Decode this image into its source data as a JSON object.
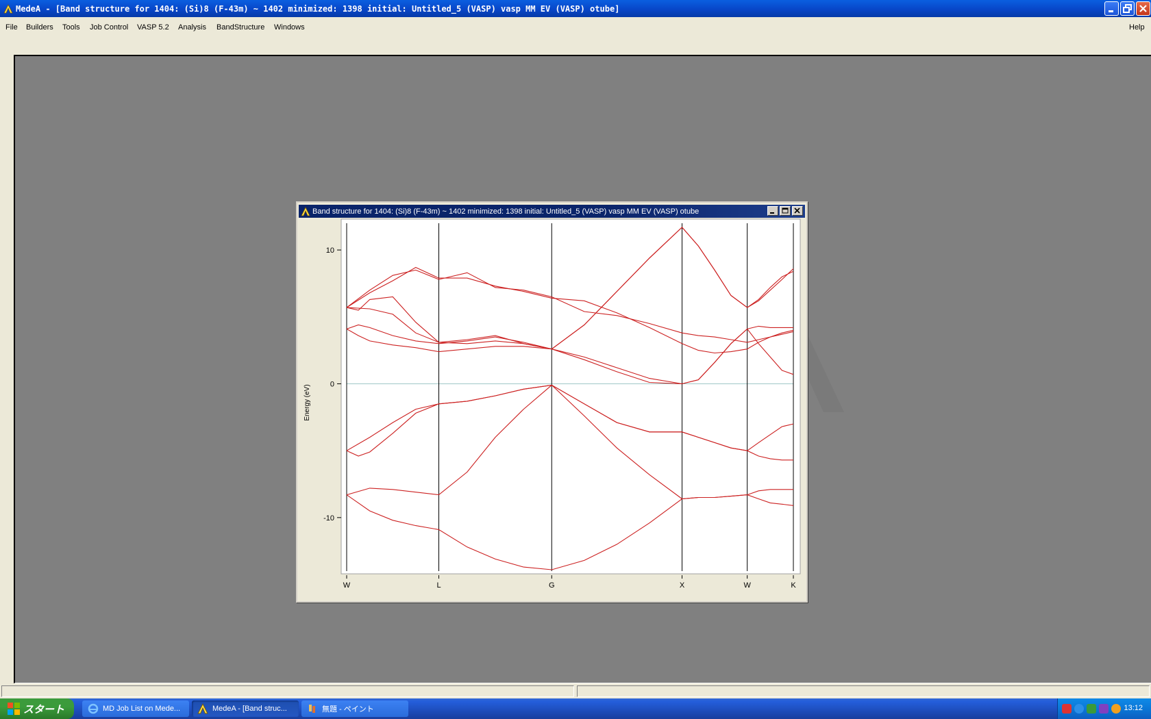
{
  "app": {
    "title": "MedeA - [Band structure for 1404: (Si)8  (F-43m) ~ 1402 minimized: 1398 initial: Untitled_5 (VASP) vasp MM EV (VASP) otube]"
  },
  "menu": {
    "items": [
      "File",
      "Builders",
      "Tools",
      "Job Control",
      "VASP 5.2",
      "Analysis",
      "BandStructure",
      "Windows"
    ],
    "help": "Help"
  },
  "child_window": {
    "title": "Band structure for 1404: (Si)8  (F-43m) ~ 1402 minimized: 1398 initial: Untitled_5 (VASP) vasp MM EV (VASP) otube"
  },
  "chart_data": {
    "type": "line",
    "ylabel": "Energy (eV)",
    "xlabel": "",
    "ylim": [
      -14,
      12
    ],
    "yticks": [
      10,
      0,
      -10
    ],
    "ytick_labels": [
      "10",
      "0",
      "-10"
    ],
    "fermi_level": 0,
    "kpath": [
      {
        "label": "W",
        "x": 0
      },
      {
        "label": "L",
        "x": 0.707
      },
      {
        "label": "G",
        "x": 1.573
      },
      {
        "label": "X",
        "x": 2.573
      },
      {
        "label": "W",
        "x": 3.073
      },
      {
        "label": "K",
        "x": 3.427
      }
    ],
    "line_color": "#cc2020",
    "series": [
      {
        "x": [
          0,
          0.177,
          0.354,
          0.53,
          0.707,
          0.924,
          1.14,
          1.357,
          1.573,
          1.823,
          2.073,
          2.323,
          2.573,
          2.698,
          2.823,
          2.948,
          3.073,
          3.16,
          3.25,
          3.34,
          3.427
        ],
        "values": [
          -8.3,
          -9.5,
          -10.2,
          -10.6,
          -10.9,
          -12.2,
          -13.1,
          -13.7,
          -13.9,
          -13.2,
          -12.0,
          -10.4,
          -8.6,
          -8.5,
          -8.5,
          -8.4,
          -8.3,
          -8.6,
          -8.9,
          -9.0,
          -9.1
        ]
      },
      {
        "x": [
          0,
          0.177,
          0.354,
          0.53,
          0.707,
          0.924,
          1.14,
          1.357,
          1.573,
          1.823,
          2.073,
          2.323,
          2.573,
          2.698,
          2.823,
          2.948,
          3.073,
          3.16,
          3.25,
          3.34,
          3.427
        ],
        "values": [
          -8.3,
          -7.8,
          -7.9,
          -8.1,
          -8.3,
          -6.6,
          -4.0,
          -1.9,
          -0.1,
          -2.4,
          -4.8,
          -6.8,
          -8.6,
          -8.5,
          -8.5,
          -8.4,
          -8.3,
          -8.0,
          -7.9,
          -7.9,
          -7.9
        ]
      },
      {
        "x": [
          0,
          0.09,
          0.177,
          0.354,
          0.53,
          0.707,
          0.924,
          1.14,
          1.357,
          1.573,
          1.823,
          2.073,
          2.323,
          2.573,
          2.698,
          2.823,
          2.948,
          3.073,
          3.16,
          3.25,
          3.34,
          3.427
        ],
        "values": [
          -5.0,
          -5.4,
          -5.1,
          -3.7,
          -2.2,
          -1.5,
          -1.3,
          -0.9,
          -0.4,
          -0.1,
          -1.5,
          -2.9,
          -3.6,
          -3.6,
          -4.0,
          -4.4,
          -4.8,
          -5.0,
          -5.4,
          -5.6,
          -5.7,
          -5.7
        ]
      },
      {
        "x": [
          0,
          0.177,
          0.354,
          0.53,
          0.707,
          0.924,
          1.14,
          1.357,
          1.573,
          1.823,
          2.073,
          2.323,
          2.573,
          2.698,
          2.823,
          2.948,
          3.073,
          3.16,
          3.25,
          3.34,
          3.427
        ],
        "values": [
          -5.0,
          -4.0,
          -2.9,
          -1.9,
          -1.5,
          -1.3,
          -0.9,
          -0.4,
          -0.1,
          -1.5,
          -2.9,
          -3.6,
          -3.6,
          -4.0,
          -4.4,
          -4.8,
          -5.0,
          -4.4,
          -3.8,
          -3.2,
          -3.0
        ]
      },
      {
        "x": [
          0,
          0.09,
          0.177,
          0.354,
          0.53,
          0.707,
          0.924,
          1.14,
          1.357,
          1.573,
          1.823,
          2.073,
          2.323,
          2.573,
          2.698,
          2.823,
          2.948,
          3.073,
          3.16,
          3.25,
          3.34,
          3.427
        ],
        "values": [
          4.1,
          3.6,
          3.2,
          2.9,
          2.7,
          2.4,
          2.6,
          2.8,
          2.8,
          2.6,
          1.8,
          0.9,
          0.1,
          0.0,
          0.3,
          1.6,
          3.0,
          4.1,
          4.3,
          4.2,
          4.2,
          4.2
        ]
      },
      {
        "x": [
          0,
          0.09,
          0.177,
          0.354,
          0.53,
          0.707,
          0.924,
          1.14,
          1.357,
          1.573,
          1.823,
          2.073,
          2.323,
          2.573,
          2.698,
          2.823,
          2.948,
          3.073,
          3.16,
          3.25,
          3.34,
          3.427
        ],
        "values": [
          4.1,
          4.4,
          4.2,
          3.6,
          3.2,
          3.0,
          3.2,
          3.5,
          3.1,
          2.6,
          2.0,
          1.2,
          0.4,
          0.0,
          0.3,
          1.6,
          3.0,
          4.1,
          3.0,
          2.0,
          1.0,
          0.7
        ]
      },
      {
        "x": [
          0,
          0.177,
          0.354,
          0.53,
          0.707,
          0.924,
          1.14,
          1.357,
          1.573,
          1.823,
          2.073,
          2.323,
          2.573,
          2.698,
          2.823,
          2.948,
          3.073,
          3.16,
          3.25,
          3.34,
          3.427
        ],
        "values": [
          5.7,
          5.6,
          5.2,
          3.8,
          3.1,
          3.0,
          3.2,
          3.0,
          2.6,
          4.4,
          6.9,
          9.4,
          11.7,
          10.3,
          8.5,
          6.6,
          5.7,
          6.3,
          7.2,
          8.0,
          8.4
        ]
      },
      {
        "x": [
          0,
          0.09,
          0.177,
          0.354,
          0.53,
          0.707,
          0.924,
          1.14,
          1.357,
          1.573,
          1.823,
          2.073,
          2.323,
          2.573,
          2.698,
          2.823,
          2.948,
          3.073,
          3.16,
          3.25,
          3.34,
          3.427
        ],
        "values": [
          5.7,
          5.5,
          6.3,
          6.5,
          4.6,
          3.1,
          3.3,
          3.6,
          3.0,
          2.6,
          4.4,
          6.9,
          9.4,
          11.7,
          10.3,
          8.5,
          6.6,
          5.7,
          6.2,
          7.0,
          7.8,
          8.6
        ]
      },
      {
        "x": [
          0,
          0.177,
          0.354,
          0.53,
          0.707,
          0.924,
          1.14,
          1.357,
          1.573,
          1.823,
          2.073,
          2.323,
          2.573,
          2.698,
          2.823,
          2.948,
          3.073,
          3.16,
          3.25,
          3.34,
          3.427
        ],
        "values": [
          5.7,
          6.8,
          7.7,
          8.7,
          7.9,
          7.9,
          7.3,
          6.9,
          6.4,
          6.2,
          5.3,
          4.2,
          3.0,
          2.5,
          2.3,
          2.4,
          2.6,
          3.1,
          3.5,
          3.8,
          4.0
        ]
      },
      {
        "x": [
          0,
          0.177,
          0.354,
          0.53,
          0.707,
          0.924,
          1.14,
          1.357,
          1.573,
          1.823,
          2.073,
          2.323,
          2.573,
          2.698,
          2.823,
          2.948,
          3.073,
          3.16,
          3.25,
          3.34,
          3.427
        ],
        "values": [
          5.7,
          7.0,
          8.1,
          8.5,
          7.8,
          8.3,
          7.2,
          7.0,
          6.5,
          5.4,
          5.1,
          4.5,
          3.8,
          3.6,
          3.5,
          3.3,
          3.1,
          3.3,
          3.5,
          3.7,
          3.9
        ]
      }
    ]
  },
  "statusbar": {
    "left": "",
    "right": ""
  },
  "taskbar": {
    "start_label": "スタート",
    "buttons": [
      {
        "label": "MD Job List on Mede..."
      },
      {
        "label": "MedeA - [Band struc..."
      },
      {
        "label": "無題 - ペイント"
      }
    ],
    "clock": "13:12"
  }
}
